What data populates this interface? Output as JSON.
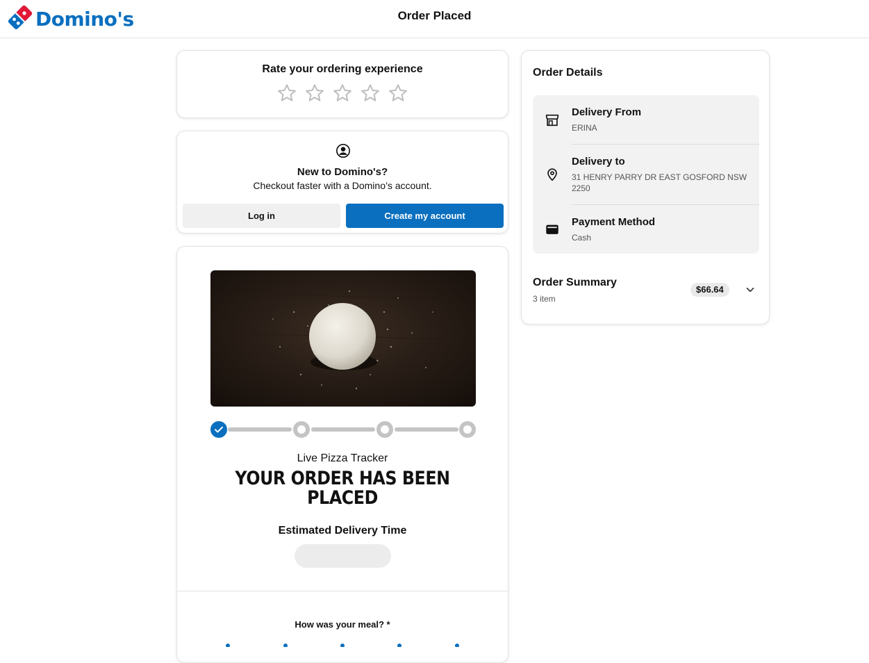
{
  "header": {
    "brand": "Domino's",
    "title": "Order Placed",
    "brand_colors": {
      "blue": "#0a6fbf",
      "red": "#e31837"
    }
  },
  "rating": {
    "title": "Rate your ordering experience",
    "max_stars": 5,
    "selected": 0
  },
  "account": {
    "title": "New to Domino's?",
    "subtitle": "Checkout faster with a Domino’s account.",
    "login_label": "Log in",
    "create_label": "Create my account"
  },
  "tracker": {
    "title": "Live Pizza Tracker",
    "status_line1": "YOUR ORDER HAS BEEN",
    "status_line2": "PLACED",
    "estimated_label": "Estimated Delivery Time",
    "steps_total": 4,
    "steps_completed": 1,
    "meal_question": "How was your meal? *",
    "accent": "#0a6fbf"
  },
  "order_details": {
    "title": "Order Details",
    "delivery_from_label": "Delivery From",
    "delivery_from_value": "ERINA",
    "delivery_to_label": "Delivery to",
    "delivery_to_value": "31 HENRY PARRY DR EAST GOSFORD NSW 2250",
    "payment_label": "Payment Method",
    "payment_value": "Cash",
    "summary_title": "Order Summary",
    "summary_items": "3 item",
    "summary_total": "$66.64"
  },
  "icons": {
    "logo": "dominos-domino-icon",
    "rating_star": "star-outline-icon",
    "account": "user-circle-icon",
    "store": "store-icon",
    "location": "map-pin-icon",
    "payment": "wallet-icon",
    "expand": "chevron-down-icon",
    "step_done": "check-circle-icon",
    "step_pending": "ring-icon"
  }
}
